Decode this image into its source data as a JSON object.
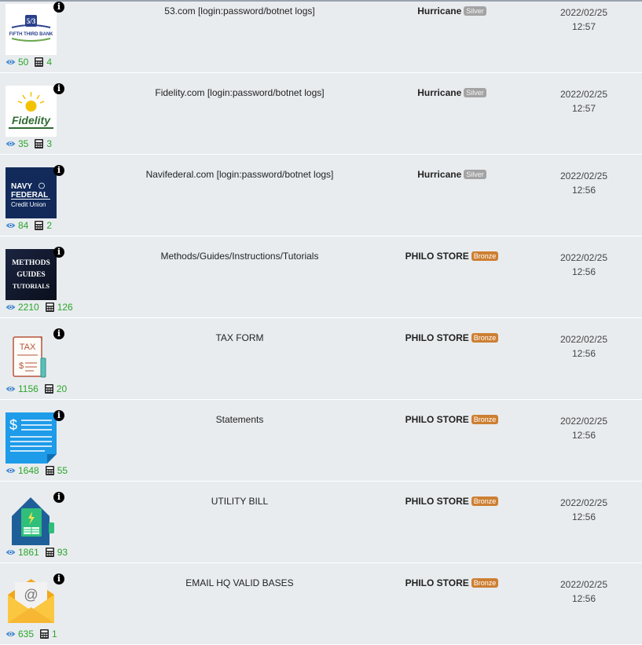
{
  "items": [
    {
      "title": "53.com [login:password/botnet logs]",
      "seller": "Hurricane",
      "badge": "Silver",
      "views": "50",
      "sales": "4",
      "date": "2022/02/25",
      "time": "12:57",
      "thumb": "fifth-third-logo",
      "thumb_text": "FIFTH THIRD BANK"
    },
    {
      "title": "Fidelity.com [login:password/botnet logs]",
      "seller": "Hurricane",
      "badge": "Silver",
      "views": "35",
      "sales": "3",
      "date": "2022/02/25",
      "time": "12:57",
      "thumb": "fidelity-logo",
      "thumb_text": "Fidelity"
    },
    {
      "title": "Navifederal.com [login:password/botnet logs]",
      "seller": "Hurricane",
      "badge": "Silver",
      "views": "84",
      "sales": "2",
      "date": "2022/02/25",
      "time": "12:56",
      "thumb": "navy-federal-logo",
      "thumb_text": "NAVY FEDERAL Credit Union"
    },
    {
      "title": "Methods/Guides/Instructions/Tutorials",
      "seller": "PHILO STORE",
      "badge": "Bronze",
      "views": "2210",
      "sales": "126",
      "date": "2022/02/25",
      "time": "12:56",
      "thumb": "methods-guides-image",
      "thumb_text": "METHODS GUIDES TUTORIALS"
    },
    {
      "title": "TAX FORM",
      "seller": "PHILO STORE",
      "badge": "Bronze",
      "views": "1156",
      "sales": "20",
      "date": "2022/02/25",
      "time": "12:56",
      "thumb": "tax-document-icon",
      "thumb_text": "TAX"
    },
    {
      "title": "Statements",
      "seller": "PHILO STORE",
      "badge": "Bronze",
      "views": "1648",
      "sales": "55",
      "date": "2022/02/25",
      "time": "12:56",
      "thumb": "statement-document-icon",
      "thumb_text": ""
    },
    {
      "title": "UTILITY BILL",
      "seller": "PHILO STORE",
      "badge": "Bronze",
      "views": "1861",
      "sales": "93",
      "date": "2022/02/25",
      "time": "12:56",
      "thumb": "utility-bill-house-icon",
      "thumb_text": ""
    },
    {
      "title": "EMAIL HQ VALID BASES",
      "seller": "PHILO STORE",
      "badge": "Bronze",
      "views": "635",
      "sales": "1",
      "date": "2022/02/25",
      "time": "12:56",
      "thumb": "email-envelope-icon",
      "thumb_text": "@"
    }
  ],
  "colors": {
    "background": "#e9ecef",
    "stat_green": "#2aa52a",
    "silver": "#a3a3a3",
    "bronze": "#cd7f32"
  },
  "icons": {
    "views": "eye-icon",
    "sales": "calculator-icon",
    "info": "info-icon"
  }
}
